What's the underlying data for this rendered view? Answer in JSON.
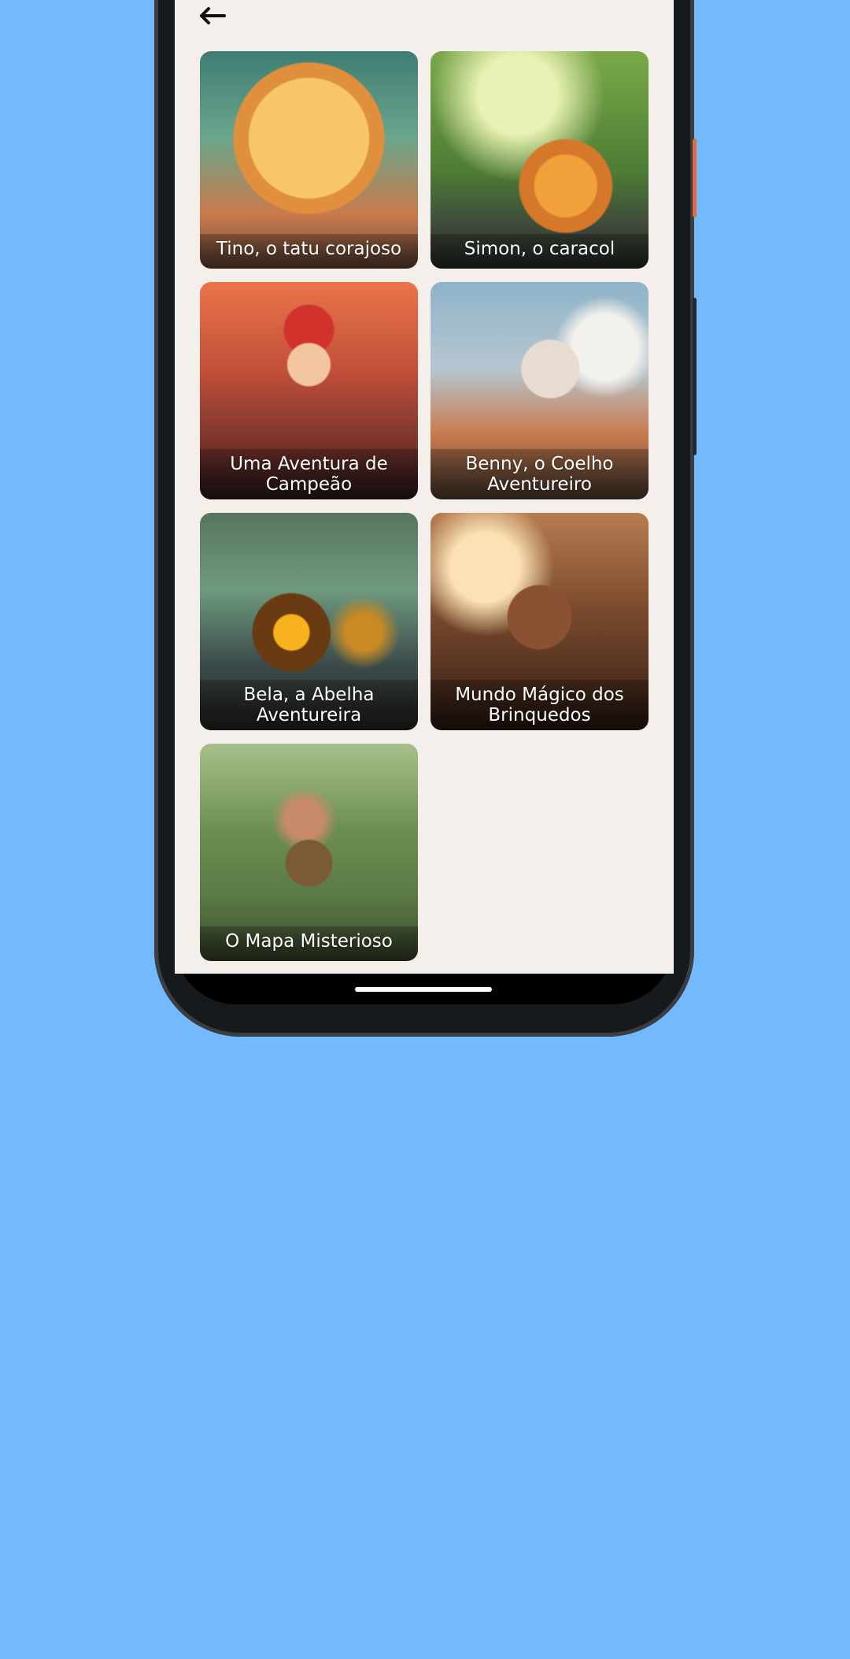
{
  "header": {
    "back_icon": "arrow-left-icon"
  },
  "stories": [
    {
      "title": "Tino, o tatu corajoso"
    },
    {
      "title": "Simon, o caracol"
    },
    {
      "title": "Uma Aventura de Campeão"
    },
    {
      "title": "Benny, o Coelho Aventureiro"
    },
    {
      "title": "Bela, a Abelha Aventureira"
    },
    {
      "title": "Mundo Mágico dos Brinquedos"
    },
    {
      "title": "O Mapa Misterioso"
    }
  ],
  "colors": {
    "background": "#73b9fe",
    "screen": "#f5efec",
    "phone_frame": "#161a1c"
  }
}
